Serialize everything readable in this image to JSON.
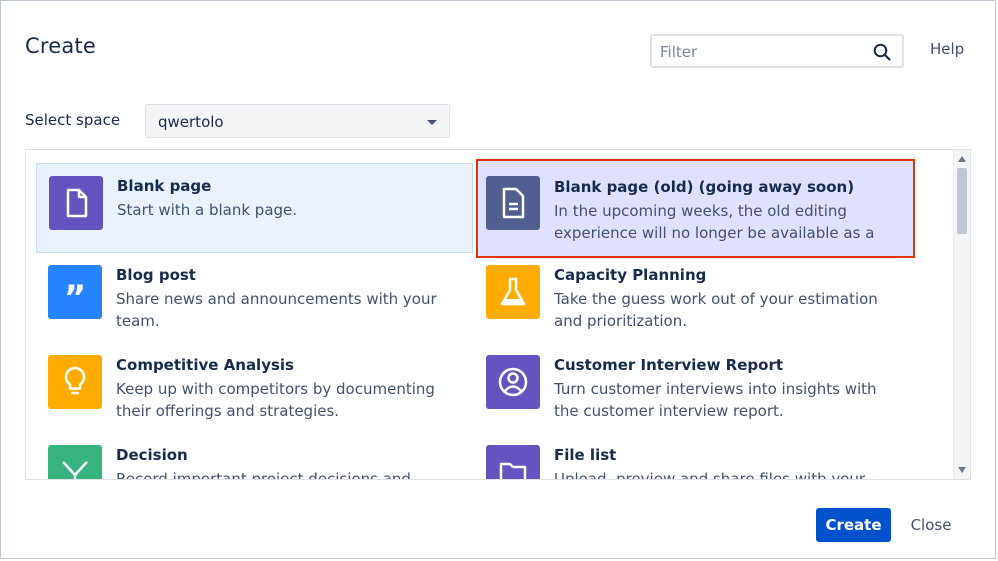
{
  "dialog": {
    "title": "Create",
    "help_label": "Help",
    "filter": {
      "placeholder": "Filter",
      "value": ""
    },
    "space": {
      "label": "Select space",
      "selected": "qwertolo"
    },
    "templates": [
      {
        "name": "Blank page",
        "description": "Start with a blank page.",
        "icon": "blank-page-icon",
        "color": "#6554c0",
        "state": "selected"
      },
      {
        "name": "Blank page (old) (going away soon)",
        "description": "In the upcoming weeks, the old editing experience will no longer be available as a",
        "icon": "document-icon",
        "color": "#505f8f",
        "state": "highlighted"
      },
      {
        "name": "Blog post",
        "description": "Share news and announcements with your team.",
        "icon": "quote-icon",
        "color": "#2684ff"
      },
      {
        "name": "Capacity Planning",
        "description": "Take the guess work out of your estimation and prioritization.",
        "icon": "flask-icon",
        "color": "#ffab00"
      },
      {
        "name": "Competitive Analysis",
        "description": "Keep up with competitors by documenting their offerings and strategies.",
        "icon": "lightbulb-icon",
        "color": "#ffab00"
      },
      {
        "name": "Customer Interview Report",
        "description": "Turn customer interviews into insights with the customer interview report.",
        "icon": "user-circle-icon",
        "color": "#6554c0"
      },
      {
        "name": "Decision",
        "description": "Record important project decisions and",
        "icon": "decision-arrows-icon",
        "color": "#36b37e"
      },
      {
        "name": "File list",
        "description": "Upload, preview and share files with your team.",
        "icon": "folder-icon",
        "color": "#6554c0"
      }
    ],
    "create_label": "Create",
    "close_label": "Close"
  }
}
